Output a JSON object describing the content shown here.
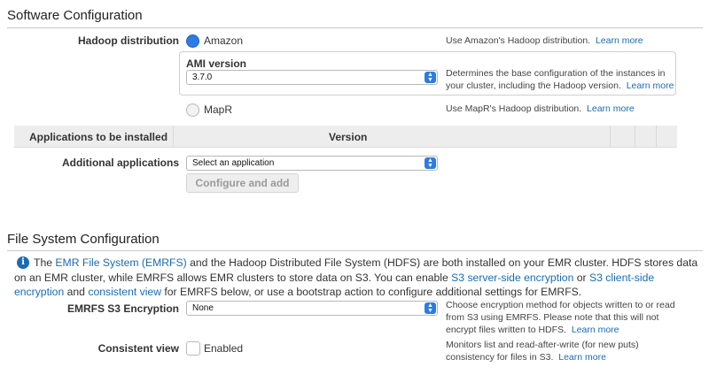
{
  "software": {
    "title": "Software Configuration",
    "hadoop_label": "Hadoop distribution",
    "amazon_label": "Amazon",
    "amazon_help": "Use Amazon's Hadoop distribution.",
    "learn_more": "Learn more",
    "ami_label": "AMI version",
    "ami_value": "3.7.0",
    "ami_help_1": "Determines the base configuration of the instances in",
    "ami_help_2": "your cluster, including the Hadoop version.",
    "mapr_label": "MapR",
    "mapr_help": "Use MapR's Hadoop distribution."
  },
  "apps": {
    "col_apps": "Applications to be installed",
    "col_version": "Version",
    "additional_label": "Additional applications",
    "select_placeholder": "Select an application",
    "configure_button": "Configure and add"
  },
  "filesystem": {
    "title": "File System Configuration",
    "info_p1": "The",
    "info_link_emrfs": "EMR File System (EMRFS)",
    "info_p2": "and the Hadoop Distributed File System (HDFS) are both installed on your EMR cluster. HDFS stores data",
    "info_p3": "on an EMR cluster, while EMRFS allows EMR clusters to store data on S3. You can enable",
    "info_link_sse": "S3 server-side encryption",
    "info_p4": "or",
    "info_link_cse": "S3 client-side",
    "info_link_cse2": "encryption",
    "info_p5": "and",
    "info_link_cv": "consistent view",
    "info_p6": "for EMRFS below, or use a bootstrap action to configure additional settings for EMRFS.",
    "encryption_label": "EMRFS S3 Encryption",
    "encryption_value": "None",
    "encryption_help_1": "Choose encryption method for objects written to or read",
    "encryption_help_2": "from S3 using EMRFS. Please note that this will not",
    "encryption_help_3": "encrypt files written to HDFS.",
    "learn_more": "Learn more",
    "consistent_label": "Consistent view",
    "enabled_label": "Enabled",
    "consistent_help_1": "Monitors list and read-after-write (for new puts)",
    "consistent_help_2": "consistency for files in S3."
  },
  "colors": {
    "link": "#1a6bb5",
    "accent": "#2d7be5",
    "header_bg": "#ededed"
  }
}
